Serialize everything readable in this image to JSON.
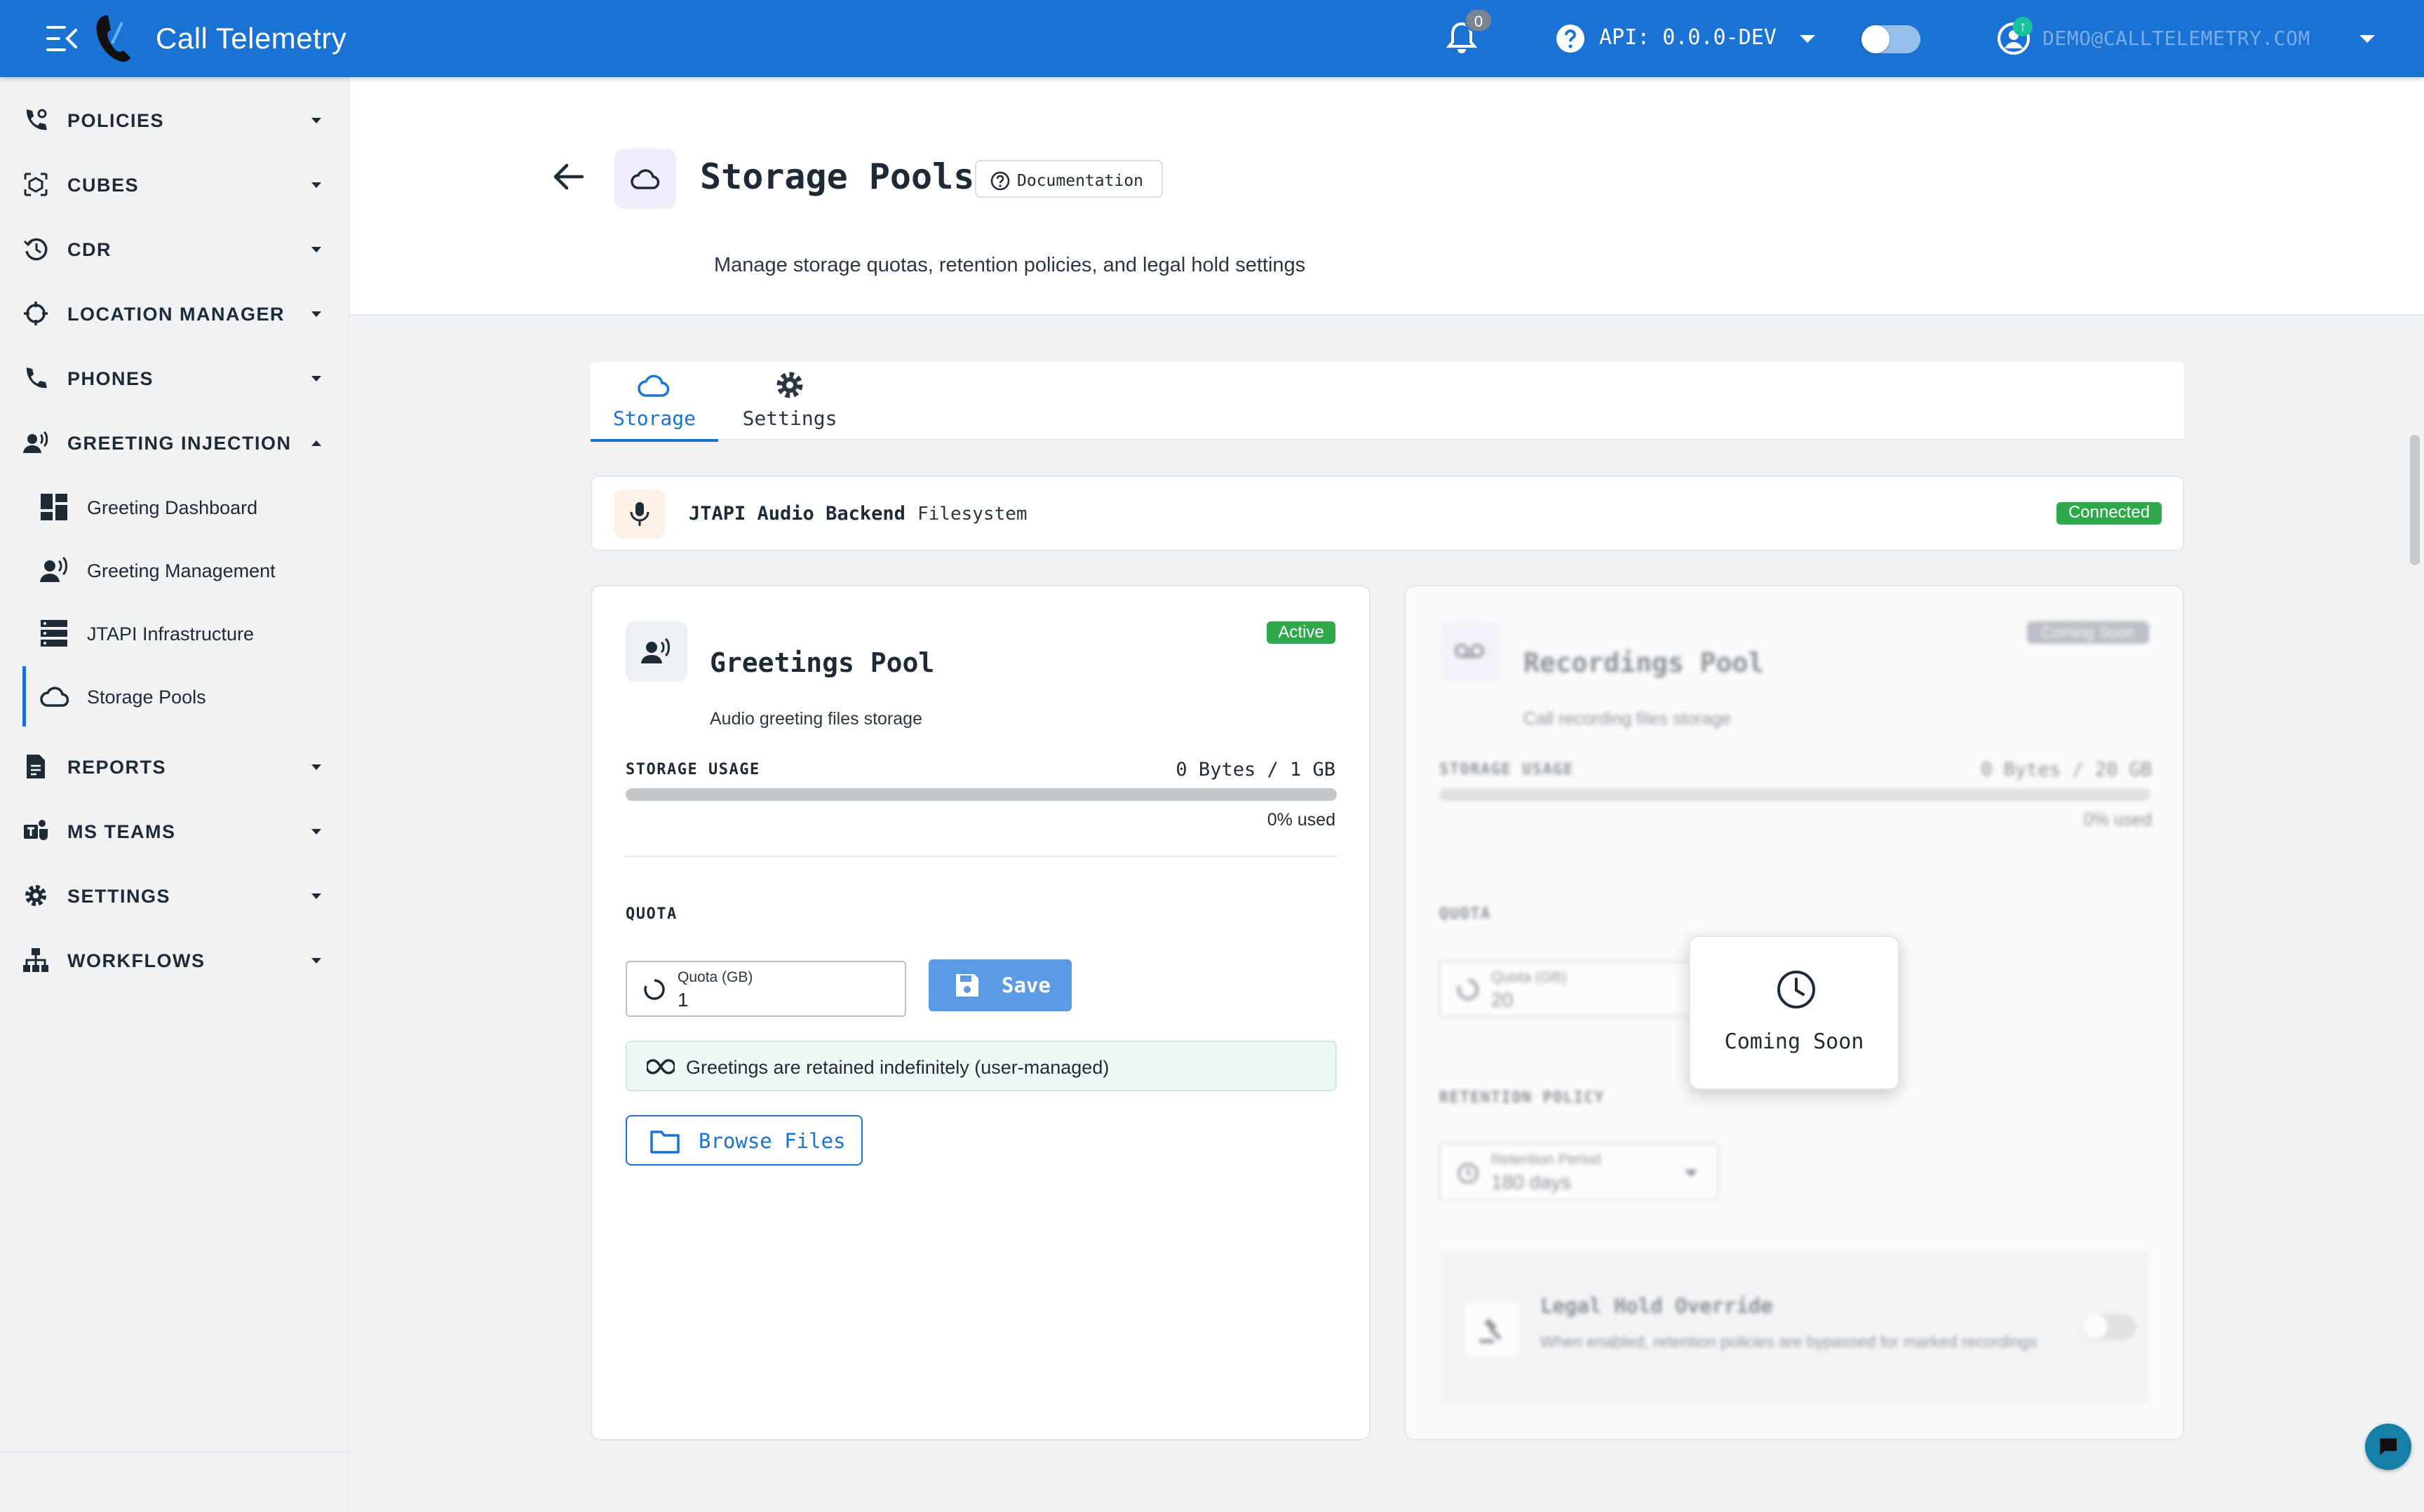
{
  "app": {
    "title": "Call Telemetry",
    "notification_count": "0",
    "api_label": "API: 0.0.0-DEV",
    "user_email": "DEMO@CALLTELEMETRY.COM",
    "brand_color": "#1a72d4"
  },
  "sidebar": {
    "items": [
      {
        "label": "POLICIES",
        "icon": "phone-settings-icon",
        "expanded": false
      },
      {
        "label": "CUBES",
        "icon": "cube-icon",
        "expanded": false
      },
      {
        "label": "CDR",
        "icon": "history-icon",
        "expanded": false
      },
      {
        "label": "LOCATION MANAGER",
        "icon": "crosshair-icon",
        "expanded": false
      },
      {
        "label": "PHONES",
        "icon": "phone-icon",
        "expanded": false
      },
      {
        "label": "GREETING INJECTION",
        "icon": "voice-person-icon",
        "expanded": true
      },
      {
        "label": "REPORTS",
        "icon": "report-icon",
        "expanded": false
      },
      {
        "label": "MS TEAMS",
        "icon": "teams-icon",
        "expanded": false
      },
      {
        "label": "SETTINGS",
        "icon": "gear-icon",
        "expanded": false
      },
      {
        "label": "WORKFLOWS",
        "icon": "sitemap-icon",
        "expanded": false
      }
    ],
    "sub_items": [
      {
        "label": "Greeting Dashboard",
        "icon": "dashboard-icon"
      },
      {
        "label": "Greeting Management",
        "icon": "voice-person-icon"
      },
      {
        "label": "JTAPI Infrastructure",
        "icon": "server-icon"
      },
      {
        "label": "Storage Pools",
        "icon": "cloud-icon",
        "active": true
      }
    ]
  },
  "header": {
    "title": "Storage Pools",
    "doc_label": "Documentation",
    "subtitle": "Manage storage quotas, retention policies, and legal hold settings"
  },
  "tabs": [
    {
      "label": "Storage",
      "icon": "cloud-icon",
      "active": true
    },
    {
      "label": "Settings",
      "icon": "gear-icon",
      "active": false
    }
  ],
  "backend": {
    "name": "JTAPI Audio Backend",
    "type": "Filesystem",
    "status": "Connected",
    "status_color": "#2ea84a"
  },
  "greetings_pool": {
    "title": "Greetings Pool",
    "subtitle": "Audio greeting files storage",
    "status": "Active",
    "usage_label": "STORAGE USAGE",
    "usage_value": "0 Bytes / 1 GB",
    "usage_fraction": 0,
    "usage_pct": "0% used",
    "quota_label": "QUOTA",
    "quota_field_label": "Quota (GB)",
    "quota_value": "1",
    "save_label": "Save",
    "retention_note": "Greetings are retained indefinitely (user-managed)",
    "browse_label": "Browse Files"
  },
  "recordings_pool": {
    "title": "Recordings Pool",
    "subtitle": "Call recording files storage",
    "status": "Coming Soon",
    "usage_label": "STORAGE USAGE",
    "usage_value": "0 Bytes / 20 GB",
    "usage_fraction": 0,
    "usage_pct": "0% used",
    "quota_label": "QUOTA",
    "quota_field_label": "Quota (GB)",
    "quota_value": "20",
    "retention_label": "RETENTION POLICY",
    "retention_field_label": "Retention Period",
    "retention_value": "180 days",
    "hold_title": "Legal Hold Override",
    "hold_desc": "When enabled, retention policies are bypassed for marked recordings",
    "overlay_label": "Coming Soon"
  }
}
